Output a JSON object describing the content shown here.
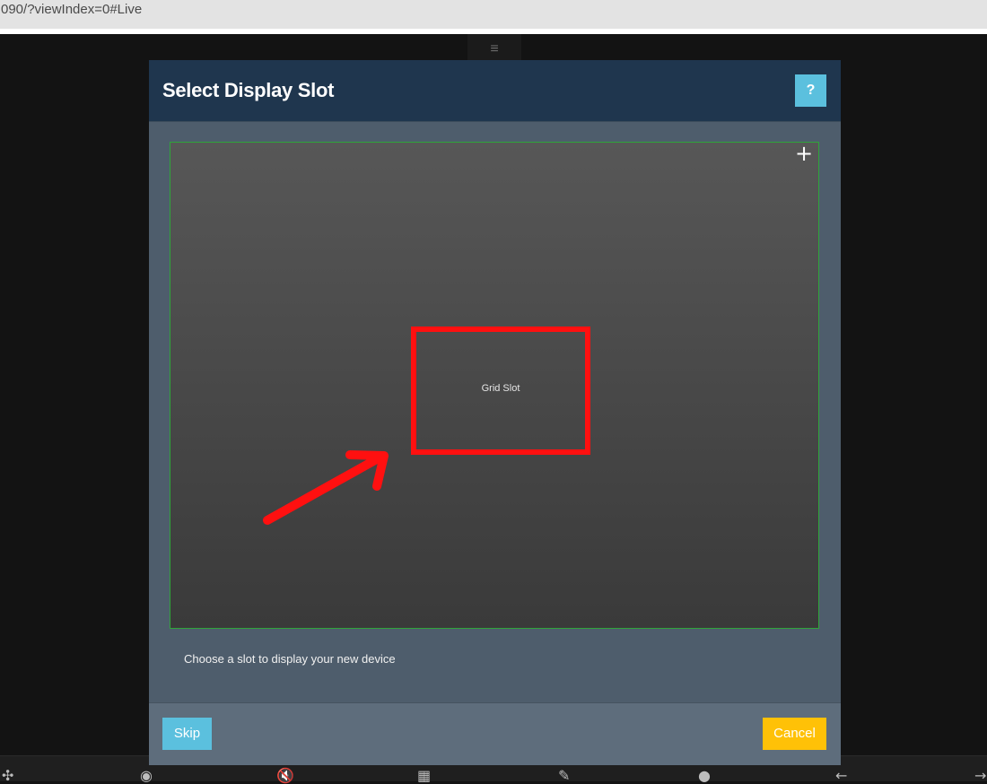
{
  "browser": {
    "url": "090/?viewIndex=0#Live"
  },
  "dialog": {
    "title": "Select Display Slot",
    "help_label": "?",
    "slot_label": "Grid Slot",
    "hint": "Choose a slot to display your new device",
    "skip_label": "Skip",
    "cancel_label": "Cancel",
    "add_icon": "plus-icon"
  },
  "bottom_toolbar": {
    "icons": [
      "ptz-icon",
      "eye-icon",
      "mute-icon",
      "grid-icon",
      "edit-icon",
      "microphone-icon",
      "arrow-left-icon",
      "arrow-right-icon"
    ]
  },
  "colors": {
    "header": "#1f364e",
    "help_button": "#5bc0de",
    "skip_button": "#5bc0de",
    "cancel_button": "#ffc107",
    "grid_border": "#2fa53a",
    "slot_highlight": "#ff1010"
  }
}
